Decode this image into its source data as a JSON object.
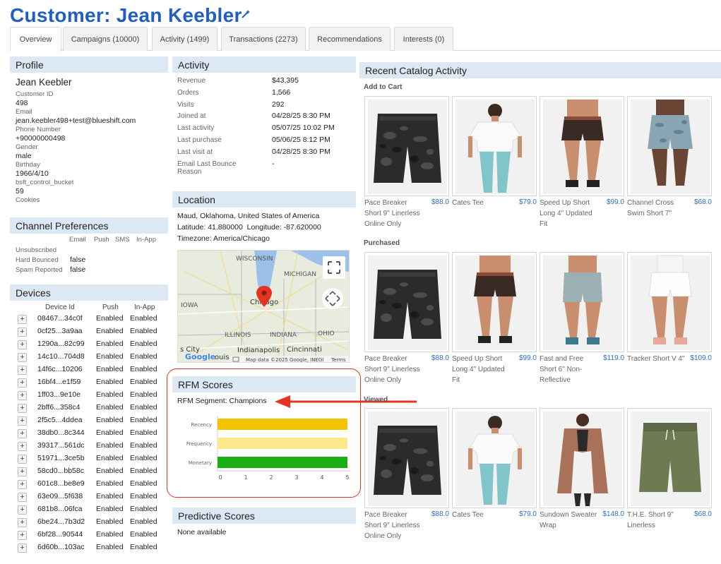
{
  "header": {
    "title": "Customer: Jean Keebler"
  },
  "tabs": [
    {
      "label": "Overview",
      "active": true
    },
    {
      "label": "Campaigns (10000)"
    },
    {
      "label": "Activity (1499)"
    },
    {
      "label": "Transactions (2273)"
    },
    {
      "label": "Recommendations"
    },
    {
      "label": "Interests (0)"
    }
  ],
  "profile": {
    "heading": "Profile",
    "name": "Jean Keebler",
    "fields": [
      {
        "label": "Customer ID",
        "value": "498"
      },
      {
        "label": "Email",
        "value": "jean.keebler498+test@blueshift.com"
      },
      {
        "label": "Phone Number",
        "value": "+90000000498"
      },
      {
        "label": "Gender",
        "value": "male"
      },
      {
        "label": "Birthday",
        "value": "1966/4/10"
      },
      {
        "label": "bsft_control_bucket",
        "value": "59"
      }
    ],
    "cookies_label": "Cookies"
  },
  "channel_prefs": {
    "heading": "Channel Preferences",
    "columns": [
      "Email",
      "Push",
      "SMS",
      "In-App"
    ],
    "rows": [
      {
        "label": "Unsubscribed",
        "value": ""
      },
      {
        "label": "Hard Bounced",
        "value": "false"
      },
      {
        "label": "Spam Reported",
        "value": "false"
      }
    ]
  },
  "devices": {
    "heading": "Devices",
    "columns": [
      "Device Id",
      "Push",
      "In-App"
    ],
    "rows": [
      {
        "id": "08467...34c0f",
        "push": "Enabled",
        "inapp": "Enabled"
      },
      {
        "id": "0cf25...3a9aa",
        "push": "Enabled",
        "inapp": "Enabled"
      },
      {
        "id": "1290a...82c99",
        "push": "Enabled",
        "inapp": "Enabled"
      },
      {
        "id": "14c10...704d8",
        "push": "Enabled",
        "inapp": "Enabled"
      },
      {
        "id": "14f6c...10206",
        "push": "Enabled",
        "inapp": "Enabled"
      },
      {
        "id": "16bf4...e1f59",
        "push": "Enabled",
        "inapp": "Enabled"
      },
      {
        "id": "1ff03...9e10e",
        "push": "Enabled",
        "inapp": "Enabled"
      },
      {
        "id": "2bff6...358c4",
        "push": "Enabled",
        "inapp": "Enabled"
      },
      {
        "id": "2f5c5...4ddea",
        "push": "Enabled",
        "inapp": "Enabled"
      },
      {
        "id": "38db0...8c344",
        "push": "Enabled",
        "inapp": "Enabled"
      },
      {
        "id": "39317...561dc",
        "push": "Enabled",
        "inapp": "Enabled"
      },
      {
        "id": "51971...3ce5b",
        "push": "Enabled",
        "inapp": "Enabled"
      },
      {
        "id": "58cd0...bb58c",
        "push": "Enabled",
        "inapp": "Enabled"
      },
      {
        "id": "601c8...be8e9",
        "push": "Enabled",
        "inapp": "Enabled"
      },
      {
        "id": "63e09...5f638",
        "push": "Enabled",
        "inapp": "Enabled"
      },
      {
        "id": "681b8...06fca",
        "push": "Enabled",
        "inapp": "Enabled"
      },
      {
        "id": "6be24...7b3d2",
        "push": "Enabled",
        "inapp": "Enabled"
      },
      {
        "id": "6bf28...90544",
        "push": "Enabled",
        "inapp": "Enabled"
      },
      {
        "id": "6d60b...103ac",
        "push": "Enabled",
        "inapp": "Enabled"
      }
    ]
  },
  "activity": {
    "heading": "Activity",
    "rows": [
      {
        "label": "Revenue",
        "value": "$43,395"
      },
      {
        "label": "Orders",
        "value": "1,566"
      },
      {
        "label": "Visits",
        "value": "292"
      },
      {
        "label": "Joined at",
        "value": "04/28/25 8:30 PM"
      },
      {
        "label": "Last activity",
        "value": "05/07/25 10:02 PM"
      },
      {
        "label": "Last purchase",
        "value": "05/06/25 8:12 PM"
      },
      {
        "label": "Last visit at",
        "value": "04/28/25 8:30 PM"
      },
      {
        "label": "Email Last Bounce Reason",
        "value": "-"
      }
    ]
  },
  "location": {
    "heading": "Location",
    "address": "Maud, Oklahoma, United States of America",
    "latlong": "Latitude: 41.880000  Longitude: -87.620000",
    "timezone": "Timezone: America/Chicago",
    "map_labels": {
      "wisconsin": "WISCONSIN",
      "michigan": "MICHIGAN",
      "iowa": "IOWA",
      "chicago": "Chicago",
      "illinois": "ILLINOIS",
      "indiana": "INDIANA",
      "ohio": "OHIO",
      "indianapolis": "Indianapolis",
      "cincinnati": "Cincinnati",
      "city": "s City",
      "louis": "ouis",
      "attribution": "Map data ©2025 Google, INEGI",
      "terms": "Terms",
      "google": "Google"
    }
  },
  "rfm": {
    "heading": "RFM Scores",
    "segment": "RFM Segment: Champions",
    "chart_data": {
      "type": "bar",
      "orientation": "horizontal",
      "categories": [
        "Recency",
        "Frequency",
        "Monetary"
      ],
      "values": [
        5,
        5,
        5
      ],
      "colors": [
        "#f5c400",
        "#fbe98b",
        "#1aae14"
      ],
      "xlim": [
        0,
        5
      ],
      "ticks": [
        "0",
        "1",
        "2",
        "3",
        "4",
        "5"
      ]
    }
  },
  "predictive": {
    "heading": "Predictive Scores",
    "text": "None available"
  },
  "catalog": {
    "heading": "Recent Catalog Activity",
    "sections": [
      {
        "label": "Add to Cart",
        "items": [
          {
            "name": "Pace Breaker Short 9\" Linerless Online Only",
            "price": "$88.0",
            "kind": "camo-shorts"
          },
          {
            "name": "Cates Tee",
            "price": "$79.0",
            "kind": "tee"
          },
          {
            "name": "Speed Up Short Long 4\" Updated Fit",
            "price": "$99.0",
            "kind": "run-short"
          },
          {
            "name": "Channel Cross Swim Short 7\"",
            "price": "$68.0",
            "kind": "swim-short"
          }
        ]
      },
      {
        "label": "Purchased",
        "items": [
          {
            "name": "Pace Breaker Short 9\" Linerless Online Only",
            "price": "$88.0",
            "kind": "camo-shorts"
          },
          {
            "name": "Speed Up Short Long 4\" Updated Fit",
            "price": "$99.0",
            "kind": "run-short"
          },
          {
            "name": "Fast and Free Short 6\" Non-Reflective",
            "price": "$119.0",
            "kind": "tight-short"
          },
          {
            "name": "Tracker Short V 4\"",
            "price": "$109.0",
            "kind": "white-short"
          }
        ]
      },
      {
        "label": "Viewed",
        "items": [
          {
            "name": "Pace Breaker Short 9\" Linerless Online Only",
            "price": "$88.0",
            "kind": "camo-shorts"
          },
          {
            "name": "Cates Tee",
            "price": "$79.0",
            "kind": "tee"
          },
          {
            "name": "Sundown Sweater Wrap",
            "price": "$148.0",
            "kind": "wrap"
          },
          {
            "name": "T.H.E. Short 9\" Linerless",
            "price": "$68.0",
            "kind": "olive-short"
          }
        ]
      }
    ]
  },
  "colors": {
    "accent": "#1f5fbf",
    "price": "#2a6fc9",
    "panel": "#dde8f5",
    "annotation": "#e53322"
  }
}
